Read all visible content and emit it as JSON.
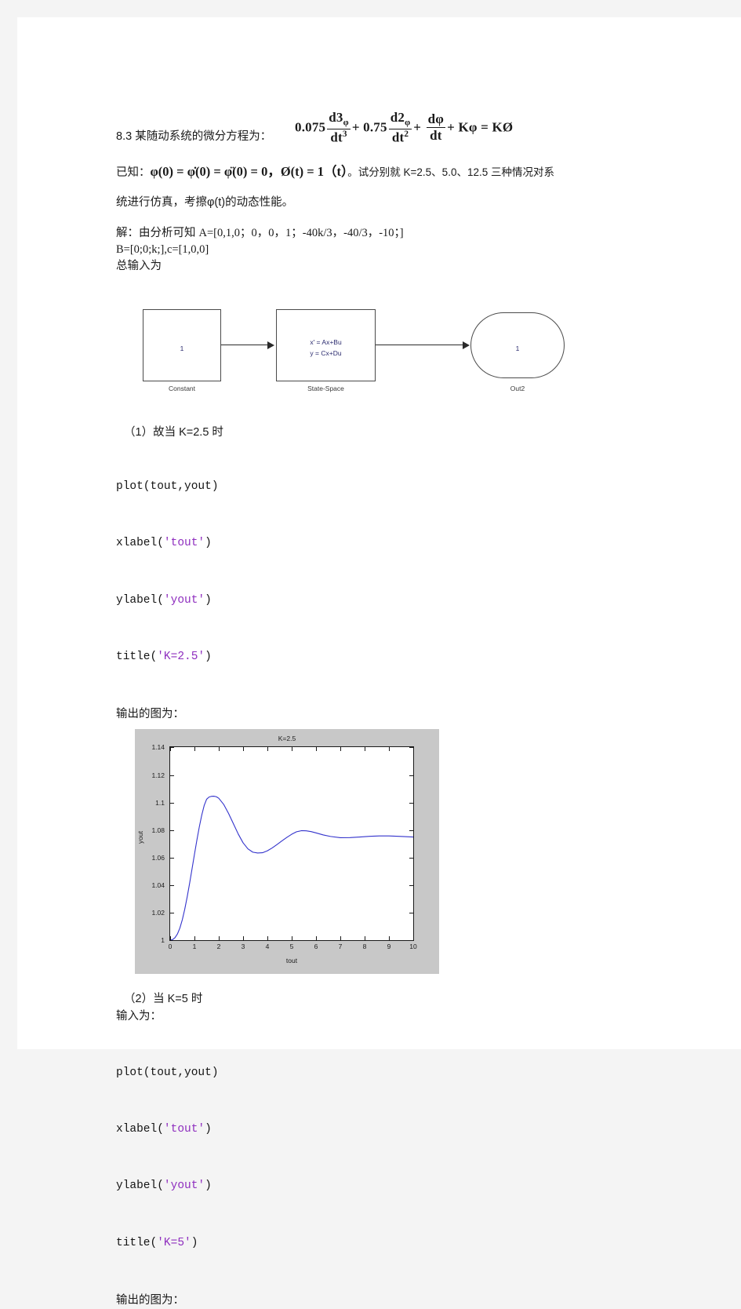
{
  "document": {
    "problem_number": "8.3",
    "problem_intro": "某随动系统的微分方程为：",
    "equation": {
      "coef1": "0.075",
      "num1": "d3",
      "num1_sub": "φ",
      "den1": "dt",
      "den1_sup": "3",
      "op1": "+",
      "coef2": "0.75",
      "num2": "d2",
      "num2_sub": "φ",
      "den2": "dt",
      "den2_sup": "2",
      "op2": "+",
      "num3": "dφ",
      "den3": "dt",
      "op3": "+",
      "tail": "Kφ = KØ"
    },
    "given_label": "已知：",
    "given_math": "φ(0) = φ̇(0) = φ̈(0) = 0，Ø(t) = 1（t）",
    "given_tail": "。试分别就 K=2.5、5.0、12.5 三种情况对系",
    "given_line2_a": "统进行仿真，考擦",
    "given_line2_math": "φ(t)",
    "given_line2_b": "的动态性能。",
    "solution_label": "解：由分析可知 ",
    "solution_matrix_a": "A=[0,1,0；0，0，1；-40k/3，-40/3，-10；]",
    "solution_matrix_b": "B=[0;0;k;],c=[1,0,0]",
    "solution_input": "总输入为"
  },
  "simulink": {
    "constant": {
      "value": "1",
      "caption": "Constant"
    },
    "state_space": {
      "line1": "x' = Ax+Bu",
      "line2": "y = Cx+Du",
      "caption": "State-Space"
    },
    "out_port": {
      "value": "1",
      "caption": "Out2"
    }
  },
  "steps": [
    {
      "head": "（1）故当 K=2.5 时",
      "pre_lines": [],
      "code": [
        {
          "fn": "plot(tout,yout)",
          "parts": [
            {
              "t": "plot(tout,yout)",
              "s": false
            }
          ]
        },
        {
          "parts": [
            {
              "t": "xlabel(",
              "s": false
            },
            {
              "t": "'tout'",
              "s": true
            },
            {
              "t": ")",
              "s": false
            }
          ]
        },
        {
          "parts": [
            {
              "t": "ylabel(",
              "s": false
            },
            {
              "t": "'yout'",
              "s": true
            },
            {
              "t": ")",
              "s": false
            }
          ]
        },
        {
          "parts": [
            {
              "t": "title(",
              "s": false
            },
            {
              "t": "'K=2.5'",
              "s": true
            },
            {
              "t": ")",
              "s": false
            }
          ]
        }
      ],
      "out_label": "输出的图为："
    },
    {
      "head": "（2）当 K=5 时",
      "pre_lines": [
        "输入为："
      ],
      "code": [
        {
          "parts": [
            {
              "t": "plot(tout,yout)",
              "s": false
            }
          ]
        },
        {
          "parts": [
            {
              "t": "xlabel(",
              "s": false
            },
            {
              "t": "'tout'",
              "s": true
            },
            {
              "t": ")",
              "s": false
            }
          ]
        },
        {
          "parts": [
            {
              "t": "ylabel(",
              "s": false
            },
            {
              "t": "'yout'",
              "s": true
            },
            {
              "t": ")",
              "s": false
            }
          ]
        },
        {
          "parts": [
            {
              "t": "title(",
              "s": false
            },
            {
              "t": "'K=5'",
              "s": true
            },
            {
              "t": ")",
              "s": false
            }
          ]
        }
      ],
      "out_label": "输出的图为："
    }
  ],
  "chart_data": {
    "type": "line",
    "title": "K=2.5",
    "xlabel": "tout",
    "ylabel": "yout",
    "xlim": [
      0,
      10
    ],
    "ylim": [
      1,
      1.14
    ],
    "xticks": [
      "0",
      "1",
      "2",
      "3",
      "4",
      "5",
      "6",
      "7",
      "8",
      "9",
      "10"
    ],
    "yticks": [
      "1",
      "1.02",
      "1.04",
      "1.06",
      "1.08",
      "1.1",
      "1.12",
      "1.14"
    ],
    "grid": false,
    "legend": null,
    "line_color": "#3333cc",
    "background": "#c8c8c8",
    "axes_background": "#ffffff",
    "series": [
      {
        "name": "yout",
        "x": [
          0,
          0.1,
          0.2,
          0.3,
          0.4,
          0.5,
          0.6,
          0.7,
          0.8,
          0.9,
          1.0,
          1.1,
          1.2,
          1.3,
          1.4,
          1.5,
          1.6,
          1.7,
          1.8,
          1.9,
          2.0,
          2.2,
          2.4,
          2.6,
          2.8,
          3.0,
          3.2,
          3.4,
          3.6,
          3.8,
          4.0,
          4.2,
          4.4,
          4.6,
          4.8,
          5.0,
          5.2,
          5.4,
          5.6,
          5.8,
          6.0,
          6.3,
          6.6,
          7.0,
          7.4,
          7.8,
          8.2,
          8.6,
          9.0,
          9.4,
          10.0
        ],
        "y": [
          1.0,
          1.0004,
          1.0018,
          1.0045,
          1.0088,
          1.0148,
          1.0224,
          1.0313,
          1.0412,
          1.0517,
          1.0623,
          1.0726,
          1.0822,
          1.0907,
          1.0977,
          1.1022,
          1.1038,
          1.1043,
          1.1044,
          1.104,
          1.1029,
          1.0985,
          1.092,
          1.0845,
          1.077,
          1.0706,
          1.0662,
          1.0638,
          1.0632,
          1.0634,
          1.0648,
          1.0669,
          1.0694,
          1.072,
          1.0745,
          1.0768,
          1.0786,
          1.0794,
          1.0793,
          1.0787,
          1.0778,
          1.0763,
          1.0752,
          1.0743,
          1.0744,
          1.0748,
          1.0753,
          1.0756,
          1.0756,
          1.0753,
          1.0748
        ]
      }
    ]
  }
}
